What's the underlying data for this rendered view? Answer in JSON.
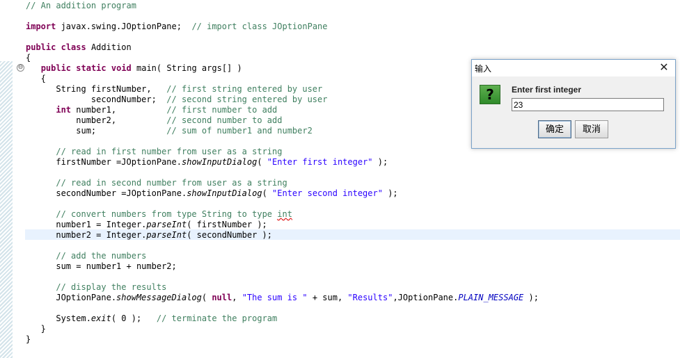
{
  "editor": {
    "lines": [
      [
        {
          "t": "// An addition program",
          "c": "cm"
        }
      ],
      [],
      [
        {
          "t": "import",
          "c": "kw"
        },
        {
          "t": " javax.swing.JOptionPane;  "
        },
        {
          "t": "// import class JOptionPane",
          "c": "cm"
        }
      ],
      [],
      [
        {
          "t": "public",
          "c": "kw"
        },
        {
          "t": " "
        },
        {
          "t": "class",
          "c": "kw"
        },
        {
          "t": " Addition"
        }
      ],
      [
        {
          "t": "{"
        }
      ],
      [
        {
          "t": "   "
        },
        {
          "t": "public",
          "c": "kw"
        },
        {
          "t": " "
        },
        {
          "t": "static",
          "c": "kw"
        },
        {
          "t": " "
        },
        {
          "t": "void",
          "c": "kw"
        },
        {
          "t": " main( String args[] )"
        }
      ],
      [
        {
          "t": "   {"
        }
      ],
      [
        {
          "t": "      String firstNumber,   "
        },
        {
          "t": "// first string entered by user",
          "c": "cm"
        }
      ],
      [
        {
          "t": "             secondNumber;  "
        },
        {
          "t": "// second string entered by user",
          "c": "cm"
        }
      ],
      [
        {
          "t": "      "
        },
        {
          "t": "int",
          "c": "kw"
        },
        {
          "t": " number1,          "
        },
        {
          "t": "// first number to add",
          "c": "cm"
        }
      ],
      [
        {
          "t": "          number2,          "
        },
        {
          "t": "// second number to add",
          "c": "cm"
        }
      ],
      [
        {
          "t": "          sum;              "
        },
        {
          "t": "// sum of number1 and number2",
          "c": "cm"
        }
      ],
      [],
      [
        {
          "t": "      "
        },
        {
          "t": "// read in first number from user as a string",
          "c": "cm"
        }
      ],
      [
        {
          "t": "      firstNumber =JOptionPane."
        },
        {
          "t": "showInputDialog",
          "c": "it"
        },
        {
          "t": "( "
        },
        {
          "t": "\"Enter first integer\"",
          "c": "st"
        },
        {
          "t": " );"
        }
      ],
      [],
      [
        {
          "t": "      "
        },
        {
          "t": "// read in second number from user as a string",
          "c": "cm"
        }
      ],
      [
        {
          "t": "      secondNumber =JOptionPane."
        },
        {
          "t": "showInputDialog",
          "c": "it"
        },
        {
          "t": "( "
        },
        {
          "t": "\"Enter second integer\"",
          "c": "st"
        },
        {
          "t": " );"
        }
      ],
      [],
      [
        {
          "t": "      "
        },
        {
          "t": "// convert numbers from type String to type ",
          "c": "cm"
        },
        {
          "t": "int",
          "c": "cm sq"
        }
      ],
      [
        {
          "t": "      number1 = Integer."
        },
        {
          "t": "parseInt",
          "c": "it"
        },
        {
          "t": "( firstNumber );"
        }
      ],
      [
        {
          "t": "      number2 = Integer."
        },
        {
          "t": "parseInt",
          "c": "it"
        },
        {
          "t": "( secondNumber );"
        }
      ],
      [],
      [
        {
          "t": "      "
        },
        {
          "t": "// add the numbers",
          "c": "cm"
        }
      ],
      [
        {
          "t": "      sum = number1 + number2;"
        }
      ],
      [],
      [
        {
          "t": "      "
        },
        {
          "t": "// display the results",
          "c": "cm"
        }
      ],
      [
        {
          "t": "      JOptionPane."
        },
        {
          "t": "showMessageDialog",
          "c": "it"
        },
        {
          "t": "( "
        },
        {
          "t": "null",
          "c": "kw"
        },
        {
          "t": ", "
        },
        {
          "t": "\"The sum is \"",
          "c": "st"
        },
        {
          "t": " + sum, "
        },
        {
          "t": "\"Results\"",
          "c": "st"
        },
        {
          "t": ",JOptionPane."
        },
        {
          "t": "PLAIN_MESSAGE",
          "c": "cn"
        },
        {
          "t": " );"
        }
      ],
      [],
      [
        {
          "t": "      System."
        },
        {
          "t": "exit",
          "c": "it"
        },
        {
          "t": "( 0 );   "
        },
        {
          "t": "// terminate the program",
          "c": "cm"
        }
      ],
      [
        {
          "t": "   }"
        }
      ],
      [
        {
          "t": "}"
        }
      ]
    ],
    "fold_marker": "⊖"
  },
  "dialog": {
    "title": "输入",
    "close_glyph": "✕",
    "icon_glyph": "?",
    "message": "Enter first integer",
    "input_value": "23",
    "ok_label": "确定",
    "cancel_label": "取消"
  }
}
